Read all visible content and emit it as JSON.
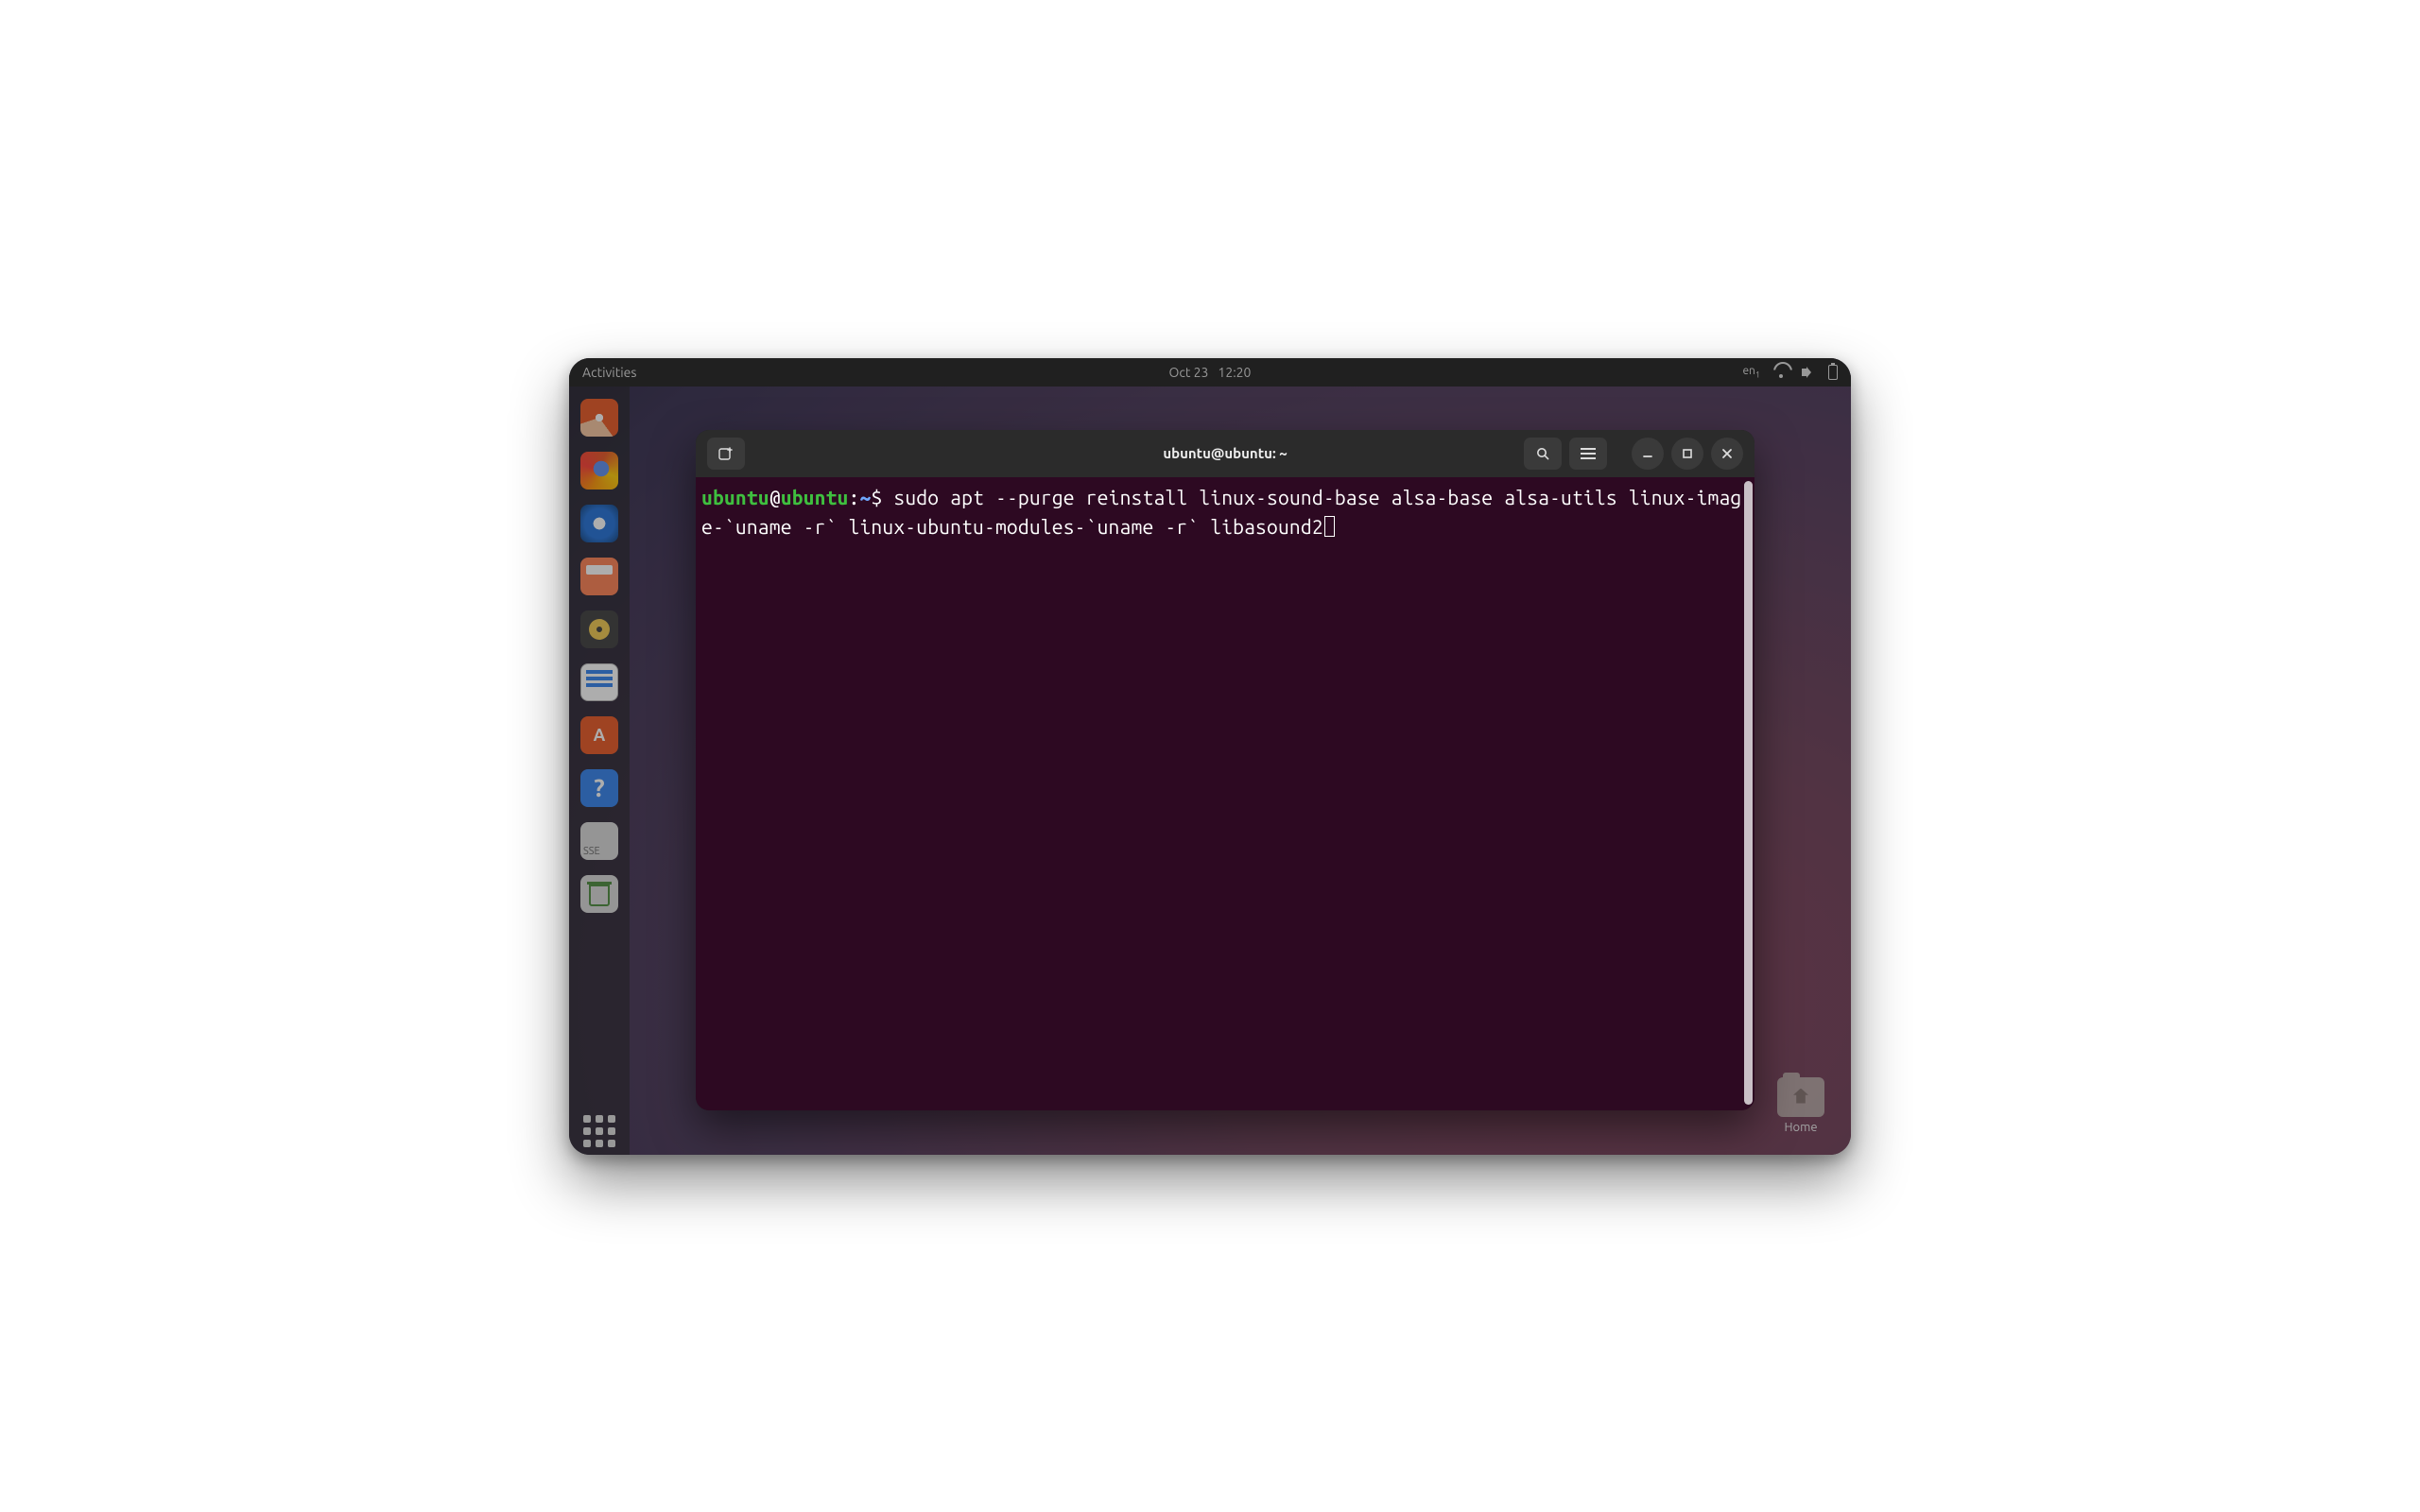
{
  "topbar": {
    "activities": "Activities",
    "date": "Oct 23",
    "time": "12:20",
    "lang": "en",
    "lang_sub": "1"
  },
  "dock": {
    "items": [
      {
        "name": "installer",
        "label": "Install Ubuntu"
      },
      {
        "name": "firefox",
        "label": "Firefox"
      },
      {
        "name": "thunderbird",
        "label": "Thunderbird"
      },
      {
        "name": "files",
        "label": "Files"
      },
      {
        "name": "rhythmbox",
        "label": "Rhythmbox"
      },
      {
        "name": "writer",
        "label": "LibreOffice Writer"
      },
      {
        "name": "software",
        "label": "Ubuntu Software"
      },
      {
        "name": "help",
        "label": "Help"
      },
      {
        "name": "screenshot",
        "label": "Screenshot"
      },
      {
        "name": "trash",
        "label": "Trash"
      }
    ],
    "screenshot_badge": "SSE"
  },
  "desktop": {
    "home_label": "Home"
  },
  "terminal": {
    "title": "ubuntu@ubuntu: ~",
    "prompt": {
      "user": "ubuntu",
      "at": "@",
      "host": "ubuntu",
      "colon": ":",
      "path": "~",
      "dollar": "$"
    },
    "command": "sudo apt --purge reinstall linux-sound-base alsa-base alsa-utils linux-image-`uname -r` linux-ubuntu-modules-`uname -r` libasound2"
  }
}
